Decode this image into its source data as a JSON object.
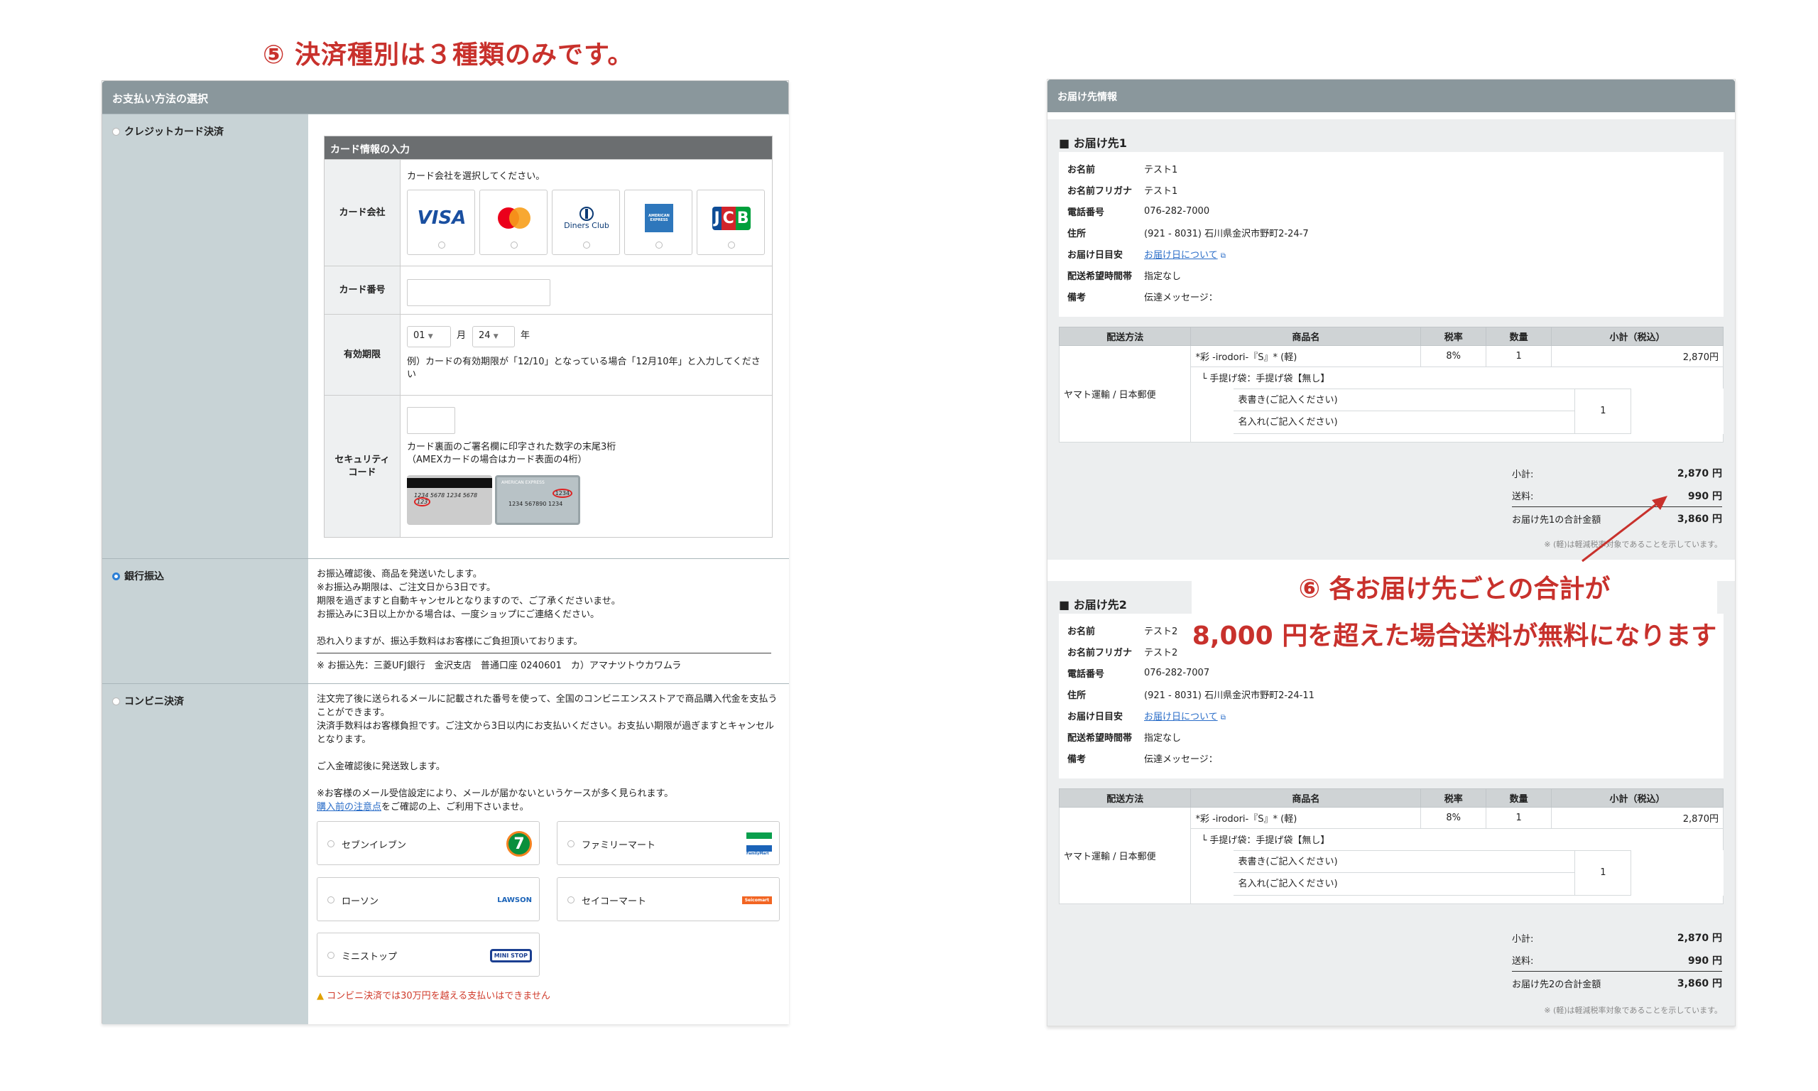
{
  "annotations": {
    "payment_note": "⑤ 決済種別は３種類のみです。",
    "shipping_note_line1": "⑥ 各お届け先ごとの合計が",
    "shipping_note_line2": "8,000 円を超えた場合送料が無料になります"
  },
  "payment": {
    "header": "お支払い方法の選択",
    "credit": {
      "label": "クレジットカード決済",
      "box_title": "カード情報の入力",
      "company_label": "カード会社",
      "company_hint": "カード会社を選択してください。",
      "brands": [
        "VISA",
        "Mastercard",
        "Diners Club",
        "AMERICAN EXPRESS",
        "JCB"
      ],
      "number_label": "カード番号",
      "expiry_label": "有効期限",
      "month_value": "01",
      "month_unit": "月",
      "year_value": "24",
      "year_unit": "年",
      "expiry_hint": "例）カードの有効期限が「12/10」となっている場合「12月10年」と入力してください",
      "security_label_1": "セキュリティ",
      "security_label_2": "コード",
      "security_hint_1": "カード裏面のご署名欄に印字された数字の末尾3桁",
      "security_hint_2": "（AMEXカードの場合はカード表面の4桁）",
      "sample_back_digits": "1234 5678 1234 5678",
      "sample_back_cvv": "123",
      "sample_front_brand": "AMERICAN EXPRESS",
      "sample_front_digits": "1234 567890 1234",
      "sample_front_cvv": "1234"
    },
    "bank": {
      "label": "銀行振込",
      "lines": [
        "お振込確認後、商品を発送いたします。",
        "※お振込み期限は、ご注文日から3日です。",
        "期限を過ぎますと自動キャンセルとなりますので、ご了承くださいませ。",
        "お振込みに3日以上かかる場合は、一度ショップにご連絡ください。",
        "",
        "恐れ入りますが、振込手数料はお客様にご負担頂いております。"
      ],
      "account": "※ お振込先：三菱UFJ銀行　金沢支店　普通口座 0240601　カ）アマナツトウカワムラ"
    },
    "convenience": {
      "label": "コンビニ決済",
      "lines": [
        "注文完了後に送られるメールに記載された番号を使って、全国のコンビニエンスストアで商品購入代金を支払うことができます。",
        "決済手数料はお客様負担です。ご注文から3日以内にお支払いください。お支払い期限が過ぎますとキャンセルとなります。",
        "",
        "ご入金確認後に発送致します。",
        "",
        "※お客様のメール受信設定により、メールが届かないというケースが多く見られます。"
      ],
      "link": "購入前の注意点",
      "link_suffix": "をご確認の上、ご利用下さいませ。",
      "stores": [
        "セブンイレブン",
        "ファミリーマート",
        "ローソン",
        "セイコーマート",
        "ミニストップ"
      ],
      "store_logos": [
        "7",
        "FamilyMart",
        "LAWSON",
        "Seicomart",
        "MINI STOP"
      ],
      "warning": "コンビニ決済では30万円を越える支払いはできません"
    }
  },
  "shipping": {
    "header": "お届け先情報",
    "fields": [
      "お名前",
      "お名前フリガナ",
      "電話番号",
      "住所",
      "お届け日目安",
      "配送希望時間帯",
      "備考"
    ],
    "columns": [
      "配送方法",
      "商品名",
      "税率",
      "数量",
      "小計（税込）"
    ],
    "destinations": [
      {
        "title": "■ お届け先1",
        "name": "テスト1",
        "kana": "テスト1",
        "phone": "076-282-7000",
        "address": "(921 - 8031) 石川県金沢市野町2-24-7",
        "date_link": "お届け日について",
        "time": "指定なし",
        "memo": "伝達メッセージ：",
        "method": "ヤマト運輸 / 日本郵便",
        "product": "*彩 -irodori-『S』* (軽)",
        "tax": "8%",
        "qty": "1",
        "price": "2,870円",
        "bag": "└ 手提げ袋：手提げ袋【無し】",
        "omote": "表書き(ご記入ください)",
        "namae": "名入れ(ご記入ください)",
        "noshi_qty": "1",
        "subtotal_label": "小計:",
        "subtotal": "2,870 円",
        "shipping_label": "送料:",
        "shipping": "990 円",
        "total_label": "お届け先1の合計金額",
        "total": "3,860 円"
      },
      {
        "title": "■ お届け先2",
        "name": "テスト2",
        "kana": "テスト2",
        "phone": "076-282-7007",
        "address": "(921 - 8031) 石川県金沢市野町2-24-11",
        "date_link": "お届け日について",
        "time": "指定なし",
        "memo": "伝達メッセージ：",
        "method": "ヤマト運輸 / 日本郵便",
        "product": "*彩 -irodori-『S』* (軽)",
        "tax": "8%",
        "qty": "1",
        "price": "2,870円",
        "bag": "└ 手提げ袋：手提げ袋【無し】",
        "omote": "表書き(ご記入ください)",
        "namae": "名入れ(ご記入ください)",
        "noshi_qty": "1",
        "subtotal_label": "小計:",
        "subtotal": "2,870 円",
        "shipping_label": "送料:",
        "shipping": "990 円",
        "total_label": "お届け先2の合計金額",
        "total": "3,860 円"
      }
    ],
    "reduced_tax_note": "※ (軽)は軽減税率対象であることを示しています。"
  },
  "colors": {
    "annotation": "#c8312c",
    "panel_header": "#8a979c",
    "label_bg": "#c8d3d6",
    "link": "#2a6dc8"
  }
}
